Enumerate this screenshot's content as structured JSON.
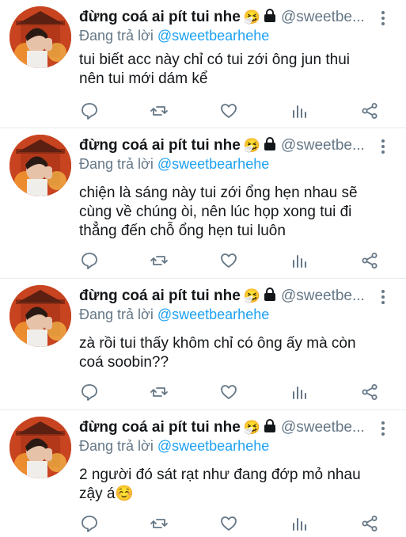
{
  "tweets": [
    {
      "name": "đừng coá ai pít tui nhe",
      "emoji": "🤧",
      "handle": "@sweetbe...",
      "reply_prefix": "Đang trả lời",
      "reply_to": "@sweetbearhehe",
      "text_lines": [
        "tui biết acc này chỉ có tui zới ông jun thui",
        "nên tui mới dám kể"
      ]
    },
    {
      "name": "đừng coá ai pít tui nhe",
      "emoji": "🤧",
      "handle": "@sweetbe...",
      "reply_prefix": "Đang trả lời",
      "reply_to": "@sweetbearhehe",
      "text_lines": [
        "chiện là sáng này tui zới ổng hẹn nhau sẽ",
        "cùng về chúng òi, nên lúc họp xong tui đi",
        "thẳng đến chỗ ổng hẹn tui luôn"
      ]
    },
    {
      "name": "đừng coá ai pít tui nhe",
      "emoji": "🤧",
      "handle": "@sweetbe...",
      "reply_prefix": "Đang trả lời",
      "reply_to": "@sweetbearhehe",
      "text_lines": [
        "zà rồi tui thấy khôm chỉ có ông ấy mà còn",
        "coá soobin??"
      ]
    },
    {
      "name": "đừng coá ai pít tui nhe",
      "emoji": "🤧",
      "handle": "@sweetbe...",
      "reply_prefix": "Đang trả lời",
      "reply_to": "@sweetbearhehe",
      "text_lines": [
        "2 người đó sát rạt như đang đớp mỏ nhau",
        "zậy á☺️"
      ]
    }
  ],
  "icons": [
    "comment-icon",
    "retweet-icon",
    "like-icon",
    "analytics-icon",
    "share-icon",
    "more-vertical-icon",
    "lock-icon"
  ],
  "colors": {
    "icon_gray": "#657786",
    "mention_blue": "#1da1f2",
    "divider": "#e6ecf0",
    "text": "#14171a"
  }
}
